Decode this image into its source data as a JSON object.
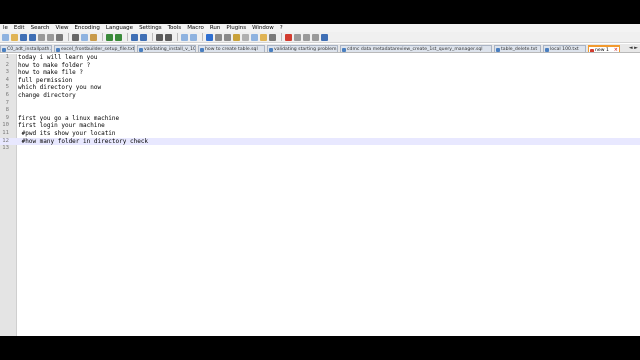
{
  "app": {
    "name": "Notepad++"
  },
  "menu": [
    "le",
    "Edit",
    "Search",
    "View",
    "Encoding",
    "Language",
    "Settings",
    "Tools",
    "Macro",
    "Run",
    "Plugins",
    "Window",
    "?"
  ],
  "toolbar": {
    "buttons": [
      {
        "name": "new-file-icon",
        "color": "#8fb3e0"
      },
      {
        "name": "open-file-icon",
        "color": "#e0b455"
      },
      {
        "name": "save-icon",
        "color": "#3f6fb5"
      },
      {
        "name": "save-all-icon",
        "color": "#3f6fb5"
      },
      {
        "name": "close-icon",
        "color": "#9a9a9a"
      },
      {
        "name": "close-all-icon",
        "color": "#9a9a9a"
      },
      {
        "name": "print-icon",
        "color": "#7a7a7a"
      },
      {
        "sep": true
      },
      {
        "name": "cut-icon",
        "color": "#666666"
      },
      {
        "name": "copy-icon",
        "color": "#8fb3e0"
      },
      {
        "name": "paste-icon",
        "color": "#c89a4a"
      },
      {
        "sep": true
      },
      {
        "name": "undo-icon",
        "color": "#3a8a3a"
      },
      {
        "name": "redo-icon",
        "color": "#3a8a3a"
      },
      {
        "sep": true
      },
      {
        "name": "find-icon",
        "color": "#3f6fb5"
      },
      {
        "name": "replace-icon",
        "color": "#3f6fb5"
      },
      {
        "sep": true
      },
      {
        "name": "zoom-in-icon",
        "color": "#5a5a5a"
      },
      {
        "name": "zoom-out-icon",
        "color": "#5a5a5a"
      },
      {
        "sep": true
      },
      {
        "name": "sync-v-icon",
        "color": "#8fb3e0"
      },
      {
        "name": "sync-h-icon",
        "color": "#8fb3e0"
      },
      {
        "sep": true
      },
      {
        "name": "word-wrap-icon",
        "color": "#2f6fd0"
      },
      {
        "name": "show-all-chars-icon",
        "color": "#8a8a8a"
      },
      {
        "name": "indent-guide-icon",
        "color": "#8a8a8a"
      },
      {
        "name": "udl-icon",
        "color": "#c9a23a"
      },
      {
        "name": "doc-map-icon",
        "color": "#b0b0b0"
      },
      {
        "name": "function-list-icon",
        "color": "#8fb3e0"
      },
      {
        "name": "folder-workspace-icon",
        "color": "#e0b455"
      },
      {
        "name": "monitoring-icon",
        "color": "#7a7a7a"
      },
      {
        "sep": true
      },
      {
        "name": "record-macro-icon",
        "color": "#d23c2f"
      },
      {
        "name": "stop-macro-icon",
        "color": "#9a9a9a"
      },
      {
        "name": "play-macro-icon",
        "color": "#9a9a9a"
      },
      {
        "name": "run-macro-multiple-icon",
        "color": "#9a9a9a"
      },
      {
        "name": "save-macro-icon",
        "color": "#3f6fb5"
      }
    ]
  },
  "tabs": [
    {
      "label": "C0_adt_installpath.txt",
      "active": false
    },
    {
      "label": "excel_frontbuilder_setup_file.txt",
      "active": false
    },
    {
      "label": "validating_install_v_10.txt",
      "active": false
    },
    {
      "label": "how to create table.sql",
      "active": false
    },
    {
      "label": "validating starting problem.txt",
      "active": false
    },
    {
      "label": "cdmc data metadatareview_create_1st_query_manager.sql",
      "active": false
    },
    {
      "label": "table_delete.txt",
      "active": false
    },
    {
      "label": "local 100.txt",
      "active": false
    },
    {
      "label": "new 1",
      "active": true
    }
  ],
  "tab_arrows": "◄ ►",
  "current_line": 12,
  "lines": [
    {
      "n": "1",
      "text": "today i will learn you"
    },
    {
      "n": "2",
      "text": "how to make folder ?"
    },
    {
      "n": "3",
      "text": "how to make file ?"
    },
    {
      "n": "4",
      "text": "full permission"
    },
    {
      "n": "5",
      "text": "which directory you now"
    },
    {
      "n": "6",
      "text": "change directory"
    },
    {
      "n": "7",
      "text": ""
    },
    {
      "n": "8",
      "text": ""
    },
    {
      "n": "9",
      "text": "first you go a linux machine"
    },
    {
      "n": "10",
      "text": "first login your machine"
    },
    {
      "n": "11",
      "text": " #pwd its show your locatin"
    },
    {
      "n": "12",
      "text": " #how many folder in directory check"
    },
    {
      "n": "13",
      "text": ""
    }
  ]
}
